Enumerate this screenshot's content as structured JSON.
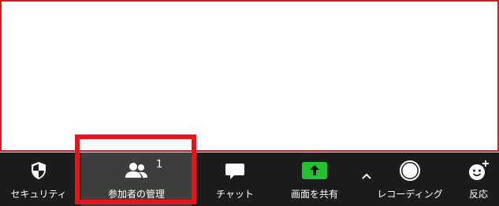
{
  "toolbar": {
    "security": {
      "label": "セキュリティ",
      "icon": "shield-icon"
    },
    "participants": {
      "label": "参加者の管理",
      "count": "1",
      "icon": "participants-icon"
    },
    "chat": {
      "label": "チャット",
      "icon": "chat-bubble-icon"
    },
    "share_screen": {
      "label": "画面を共有",
      "icon": "share-arrow-icon"
    },
    "share_options": {
      "icon": "caret-up-icon"
    },
    "record": {
      "label": "レコーディング",
      "icon": "record-circle-icon"
    },
    "reactions": {
      "label": "反応",
      "icon": "emoji-add-icon"
    }
  },
  "colors": {
    "toolbar_bg": "#1c1c1c",
    "highlight": "#e6141d",
    "share_green": "#23c12f",
    "active_bg": "#3e3e3e"
  }
}
